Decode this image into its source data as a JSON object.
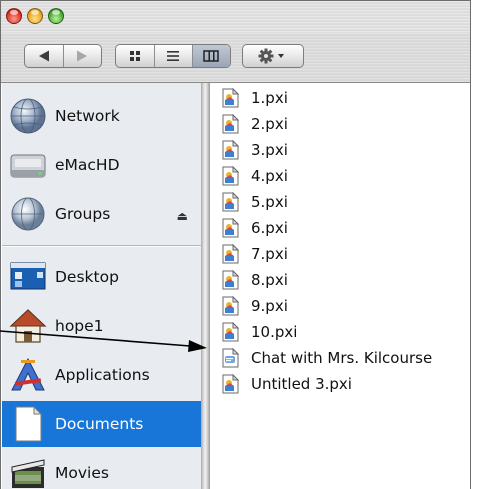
{
  "window": {
    "controls": {
      "close": "close-button",
      "minimize": "minimize-button",
      "zoom": "zoom-button"
    }
  },
  "toolbar": {
    "back_icon": "back-arrow-icon",
    "forward_icon": "forward-arrow-icon",
    "views": [
      {
        "icon": "icon-view-icon",
        "active": false
      },
      {
        "icon": "list-view-icon",
        "active": false
      },
      {
        "icon": "column-view-icon",
        "active": true
      }
    ],
    "action_icon": "gear-icon"
  },
  "sidebar": {
    "items": [
      {
        "label": "Network",
        "icon": "network-globe-icon",
        "selected": false
      },
      {
        "label": "eMacHD",
        "icon": "hard-drive-icon",
        "selected": false
      },
      {
        "label": "Groups",
        "icon": "groups-globe-icon",
        "selected": false,
        "eject": "⏏"
      },
      {
        "label": "Desktop",
        "icon": "desktop-icon",
        "selected": false
      },
      {
        "label": "hope1",
        "icon": "home-icon",
        "selected": false
      },
      {
        "label": "Applications",
        "icon": "applications-icon",
        "selected": false
      },
      {
        "label": "Documents",
        "icon": "documents-icon",
        "selected": true
      },
      {
        "label": "Movies",
        "icon": "movies-icon",
        "selected": false
      }
    ]
  },
  "files": [
    {
      "name": "1.pxi",
      "icon": "pxi-file-icon"
    },
    {
      "name": "2.pxi",
      "icon": "pxi-file-icon"
    },
    {
      "name": "3.pxi",
      "icon": "pxi-file-icon"
    },
    {
      "name": "4.pxi",
      "icon": "pxi-file-icon"
    },
    {
      "name": "5.pxi",
      "icon": "pxi-file-icon"
    },
    {
      "name": "6.pxi",
      "icon": "pxi-file-icon"
    },
    {
      "name": "7.pxi",
      "icon": "pxi-file-icon"
    },
    {
      "name": "8.pxi",
      "icon": "pxi-file-icon"
    },
    {
      "name": "9.pxi",
      "icon": "pxi-file-icon"
    },
    {
      "name": "10.pxi",
      "icon": "pxi-file-icon"
    },
    {
      "name": "Chat with Mrs. Kilcourse",
      "icon": "chat-file-icon"
    },
    {
      "name": "Untitled 3.pxi",
      "icon": "pxi-file-icon"
    }
  ],
  "colors": {
    "selection": "#1776d8",
    "sidebar_bg": "#e8ecf1",
    "arrow": "#000000"
  }
}
